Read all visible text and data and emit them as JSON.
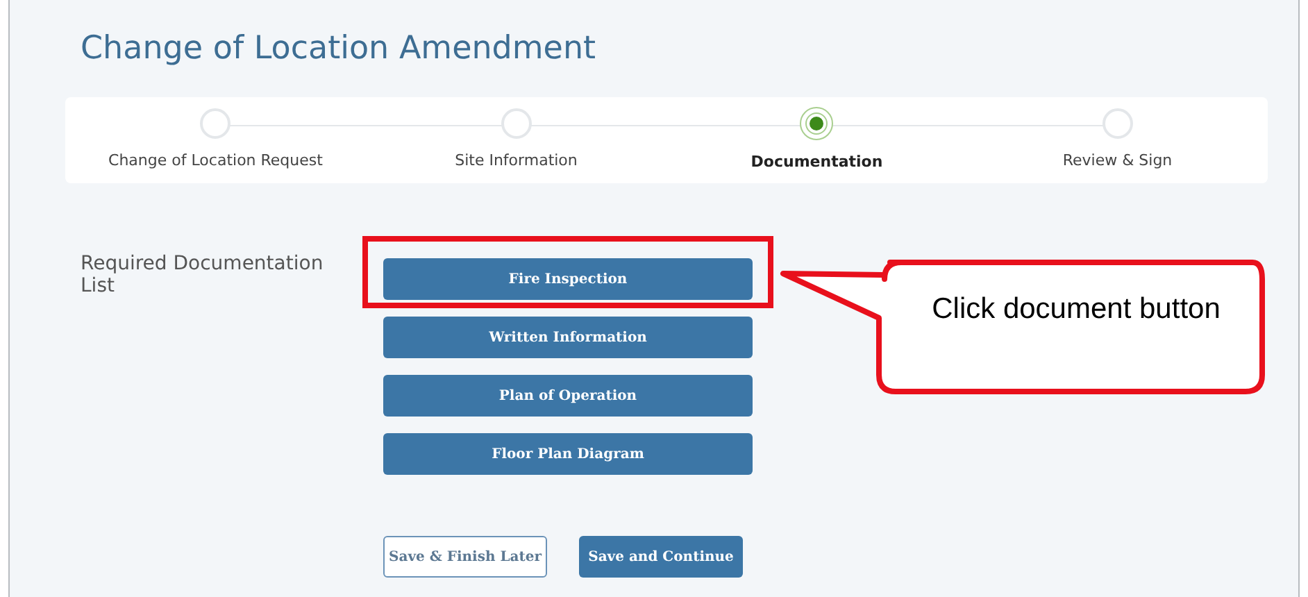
{
  "title": "Change of Location Amendment",
  "steps": [
    {
      "label": "Change of Location Request",
      "selected": false
    },
    {
      "label": "Site Information",
      "selected": false
    },
    {
      "label": "Documentation",
      "selected": true
    },
    {
      "label": "Review & Sign",
      "selected": false
    }
  ],
  "documentation": {
    "label": "Required Documentation List",
    "buttons": [
      "Fire Inspection",
      "Written Information",
      "Plan of Operation",
      "Floor Plan Diagram"
    ]
  },
  "actions": [
    {
      "label": "Save & Finish Later",
      "kind": "secondary"
    },
    {
      "label": "Save and Continue",
      "kind": "primary"
    }
  ],
  "annotation": {
    "text": "Click document button"
  }
}
